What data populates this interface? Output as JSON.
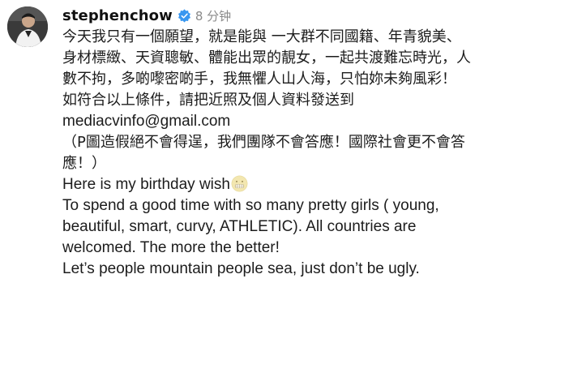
{
  "post": {
    "username": "stephenchow",
    "verified_icon": "verified-badge-icon",
    "timestamp": "8 分钟",
    "avatar_icon": "profile-avatar"
  },
  "caption": {
    "cn_paragraph_1": "今天我只有一個願望，就是能與 一大群不同國籍、年青貌美、\n身材標緻、天資聰敏、體能出眾的靚女，一起共渡難忘時光，人\n數不拘，多啲嚟密啲手，我無懼人山人海，只怕妳未夠風彩！",
    "cn_paragraph_2": "如符合以上條件，請把近照及個人資料發送到",
    "email": "mediacvinfo@gmail.com",
    "cn_paragraph_3": "（P圖造假絕不會得逞，我們團隊不會答應！國際社會更不會答\n應！）",
    "en_paragraph_1": "Here is my birthday wish",
    "en_paragraph_1_emoji": "grimacing-face-emoji",
    "en_paragraph_2": "To spend a good time with so many pretty girls ( young,\nbeautiful, smart, curvy, ATHLETIC). All countries are\nwelcomed. The more the better!",
    "en_paragraph_3": "Let’s people mountain people sea, just don’t be ugly."
  },
  "colors": {
    "text": "#1c1c1c",
    "timestamp": "#8a8a8a",
    "verified_blue": "#3897f0",
    "background": "#ffffff"
  }
}
